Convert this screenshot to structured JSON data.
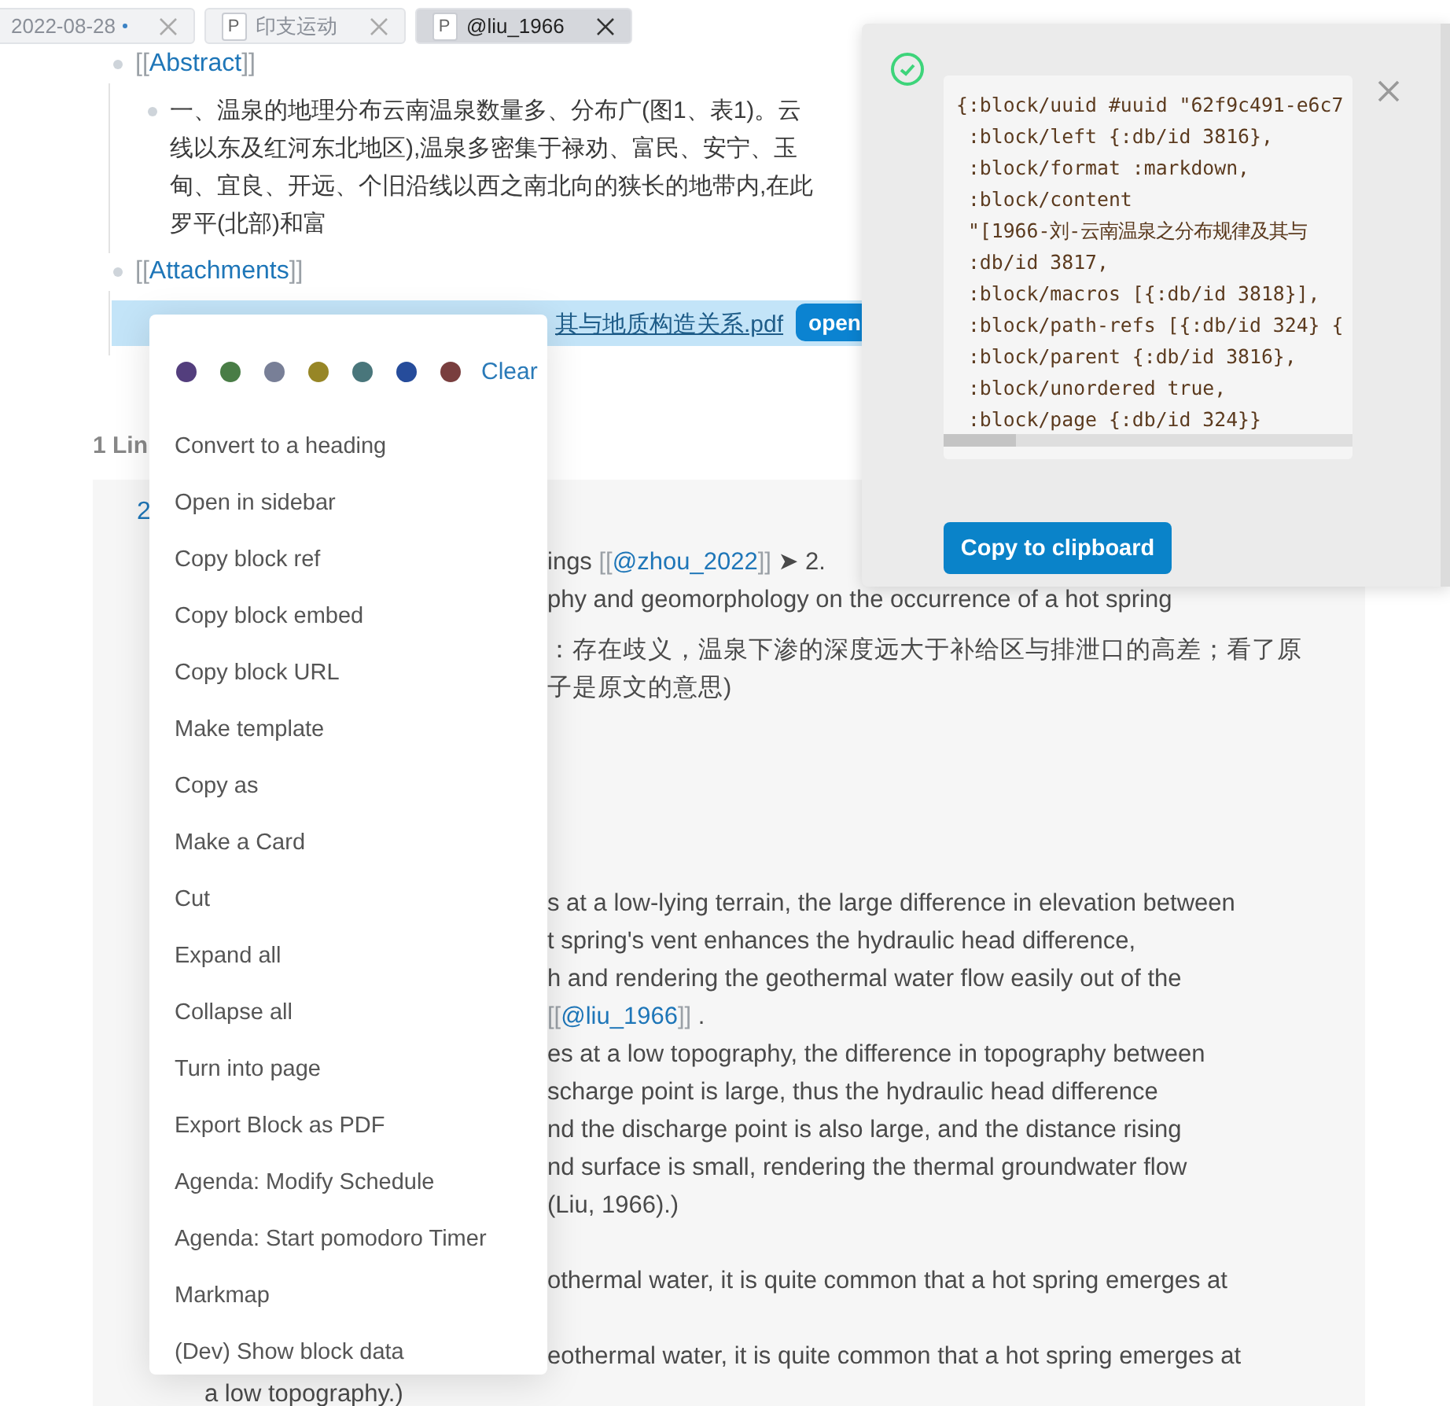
{
  "tabs": [
    {
      "label": "2022-08-28",
      "dirty": true,
      "selected": false
    },
    {
      "label": "印支运动",
      "icon": "P",
      "dirty": false,
      "selected": false
    },
    {
      "label": "@liu_1966",
      "icon": "P",
      "dirty": false,
      "selected": true
    }
  ],
  "blocks": [
    {
      "open": "[[",
      "title": "Abstract",
      "close": "]]",
      "children": [
        {
          "lines": [
            "一、温泉的地理分布云南温泉数量多、分布广(图1、表1)。云",
            "线以东及红河东北地区),温泉多密集于禄劝、富民、安宁、玉",
            "甸、宜良、开远、个旧沿线以西之南北向的狭长的地带内,在此",
            "罗平(北部)和富"
          ],
          "selected": false
        }
      ]
    },
    {
      "open": "[[",
      "title": "Attachments",
      "close": "]]",
      "children": [
        {
          "lines": [
            "其与地质构造关系.pdf"
          ],
          "button": "open",
          "selected": true
        }
      ]
    }
  ],
  "linked": {
    "heading": "1 Lin",
    "number": "2",
    "paragraphs": [
      [
        [
          {
            "t": "ings ",
            "kind": "plain"
          },
          {
            "t": "[[",
            "kind": "bracket"
          },
          {
            "t": "@zhou_2022",
            "kind": "link"
          },
          {
            "t": "]]",
            "kind": "bracket"
          },
          {
            "t": " ➤ 2.",
            "kind": "plain"
          }
        ],
        [
          {
            "t": "phy and geomorphology on the occurrence of a hot spring",
            "kind": "plain"
          }
        ]
      ],
      [
        [
          {
            "t": "：存在歧义，温泉下渗的深度远大于补给区与排泄口的高差；看了原",
            "kind": "plain"
          }
        ],
        [
          {
            "t": "子是原文的意思)",
            "kind": "plain"
          }
        ]
      ],
      [
        [
          {
            "t": "s at a low-lying terrain, the large difference in elevation between",
            "kind": "plain"
          }
        ],
        [
          {
            "t": "t spring's vent enhances the hydraulic head difference,",
            "kind": "plain"
          }
        ],
        [
          {
            "t": "h and rendering  the geothermal water flow easily out of the",
            "kind": "plain"
          }
        ],
        [
          {
            "t": "[[",
            "kind": "bracket"
          },
          {
            "t": "@liu_1966",
            "kind": "link"
          },
          {
            "t": "]]",
            "kind": "bracket"
          },
          {
            "t": " .",
            "kind": "plain"
          }
        ],
        [
          {
            "t": "es at a low topography, the difference in topography between",
            "kind": "plain"
          }
        ],
        [
          {
            "t": "scharge point is large, thus the hydraulic head difference",
            "kind": "plain"
          }
        ],
        [
          {
            "t": "nd the discharge point is also large, and the distance rising",
            "kind": "plain"
          }
        ],
        [
          {
            "t": "nd surface is small, rendering  the thermal groundwater flow",
            "kind": "plain"
          }
        ],
        [
          {
            "t": "(Liu, 1966).)",
            "kind": "plain"
          }
        ]
      ],
      [
        [
          {
            "t": "othermal water, it is quite common that a hot spring emerges at",
            "kind": "plain"
          }
        ]
      ],
      [
        [
          {
            "t": "eothermal water, it is quite common that a hot spring emerges at",
            "kind": "plain"
          }
        ]
      ]
    ],
    "tail": "a low topography.)"
  },
  "context_menu": {
    "colors": [
      {
        "color": "#533e7d"
      },
      {
        "color": "#497d46"
      },
      {
        "color": "#787f97"
      },
      {
        "color": "#978626"
      },
      {
        "color": "#49767b"
      },
      {
        "color": "#264c9b"
      },
      {
        "color": "#793e3e"
      }
    ],
    "clear": "Clear",
    "items": [
      "Convert to a heading",
      "Open in sidebar",
      "Copy block ref",
      "Copy block embed",
      "Copy block URL",
      "Make template",
      "Copy as",
      "Make a Card",
      "Cut",
      "Expand all",
      "Collapse all",
      "Turn into page",
      "Export Block as PDF",
      "Agenda: Modify Schedule",
      "Agenda: Start pomodoro Timer",
      "Markmap",
      "(Dev) Show block data"
    ]
  },
  "notification": {
    "code": [
      "{:block/uuid #uuid \"62f9c491-e6c7",
      " :block/left {:db/id 3816},",
      " :block/format :markdown,",
      " :block/content",
      " \"[1966-刘-云南温泉之分布规律及其与",
      " :db/id 3817,",
      " :block/macros [{:db/id 3818}],",
      " :block/path-refs [{:db/id 324} {",
      " :block/parent {:db/id 3816},",
      " :block/unordered true,",
      " :block/page {:db/id 324}}"
    ],
    "button": "Copy to clipboard"
  }
}
